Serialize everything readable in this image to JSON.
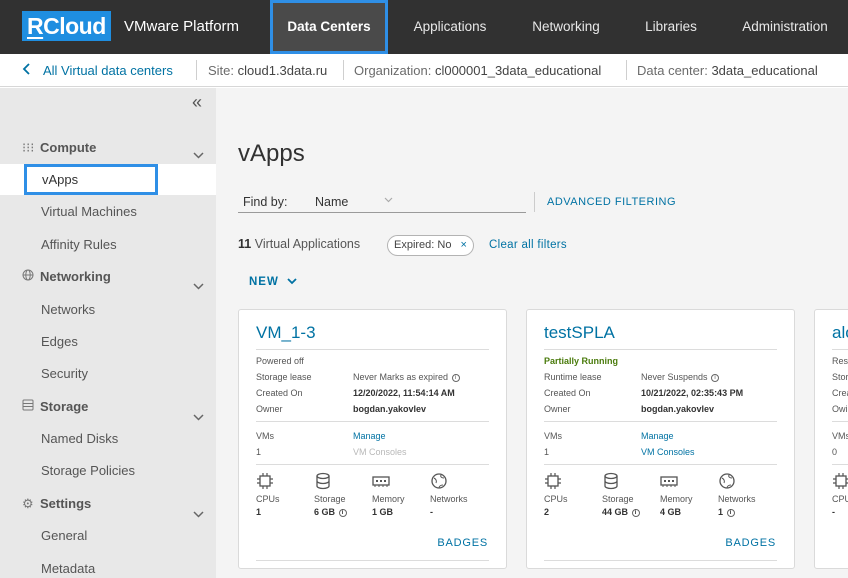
{
  "header": {
    "logo": "RCloud",
    "logo_r": "R",
    "logo_rest": "Cloud",
    "brand": "VMware Platform",
    "tabs": [
      {
        "label": "Data Centers",
        "active": true
      },
      {
        "label": "Applications"
      },
      {
        "label": "Networking"
      },
      {
        "label": "Libraries"
      },
      {
        "label": "Administration"
      }
    ]
  },
  "context": {
    "back_label": "All Virtual data centers",
    "site_label": "Site:",
    "site": "cloud1.3data.ru",
    "org_label": "Organization:",
    "org": "cl000001_3data_educational",
    "dc_label": "Data center:",
    "dc": "3data_educational"
  },
  "sidebar": {
    "sections": [
      {
        "title": "Compute",
        "icon": "grid-icon",
        "items": [
          "vApps",
          "Virtual Machines",
          "Affinity Rules"
        ]
      },
      {
        "title": "Networking",
        "icon": "globe-icon",
        "items": [
          "Networks",
          "Edges",
          "Security"
        ]
      },
      {
        "title": "Storage",
        "icon": "database-icon",
        "items": [
          "Named Disks",
          "Storage Policies"
        ]
      },
      {
        "title": "Settings",
        "icon": "gear-icon",
        "items": [
          "General",
          "Metadata"
        ]
      }
    ],
    "active_item": "vApps"
  },
  "main": {
    "title": "vApps",
    "find_by_label": "Find by:",
    "find_by_value": "Name",
    "advanced_filtering": "ADVANCED FILTERING",
    "count_number": "11",
    "count_text": "Virtual Applications",
    "filter_chip_label": "Expired:",
    "filter_chip_value": "No",
    "clear_filters": "Clear all filters",
    "new_button": "NEW",
    "cards": [
      {
        "title": "VM_1-3",
        "status": "Powered off",
        "lease_label": "Storage lease",
        "lease_value": "Never Marks as expired",
        "created_label": "Created On",
        "created_value": "12/20/2022, 11:54:14 AM",
        "owner_label": "Owner",
        "owner_value": "bogdan.yakovlev",
        "vms_label": "VMs",
        "vms_value": "1",
        "manage": "Manage",
        "consoles": "VM Consoles",
        "cpus_label": "CPUs",
        "cpus": "1",
        "storage_label": "Storage",
        "storage": "6 GB",
        "memory_label": "Memory",
        "memory": "1 GB",
        "networks_label": "Networks",
        "networks": "-",
        "badges": "BADGES"
      },
      {
        "title": "testSPLA",
        "status": "Partially Running",
        "lease_label": "Runtime lease",
        "lease_value": "Never Suspends",
        "created_label": "Created On",
        "created_value": "10/21/2022, 02:35:43 PM",
        "owner_label": "Owner",
        "owner_value": "bogdan.yakovlev",
        "vms_label": "VMs",
        "vms_value": "1",
        "manage": "Manage",
        "consoles": "VM Consoles",
        "cpus_label": "CPUs",
        "cpus": "2",
        "storage_label": "Storage",
        "storage": "44 GB",
        "memory_label": "Memory",
        "memory": "4 GB",
        "networks_label": "Networks",
        "networks": "1",
        "badges": "BADGES"
      },
      {
        "title": "alo",
        "status": "Res",
        "lease_label": "Stor",
        "created_label": "Crea",
        "owner_label": "Owi",
        "vms_label": "VMs",
        "vms_value": "0",
        "cpus_label": "CPU",
        "cpus": "-"
      }
    ]
  }
}
